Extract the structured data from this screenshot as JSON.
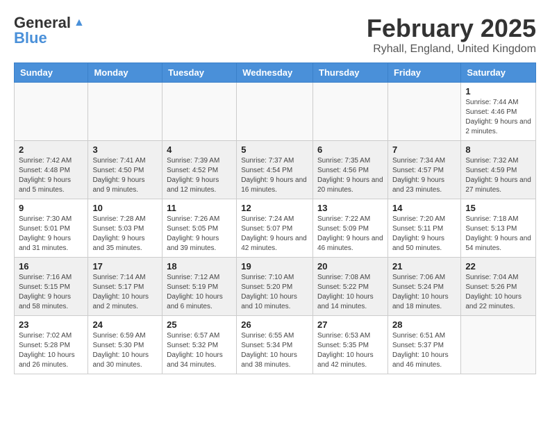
{
  "header": {
    "logo_general": "General",
    "logo_blue": "Blue",
    "title": "February 2025",
    "subtitle": "Ryhall, England, United Kingdom"
  },
  "days_of_week": [
    "Sunday",
    "Monday",
    "Tuesday",
    "Wednesday",
    "Thursday",
    "Friday",
    "Saturday"
  ],
  "weeks": [
    {
      "days": [
        {
          "num": "",
          "info": ""
        },
        {
          "num": "",
          "info": ""
        },
        {
          "num": "",
          "info": ""
        },
        {
          "num": "",
          "info": ""
        },
        {
          "num": "",
          "info": ""
        },
        {
          "num": "",
          "info": ""
        },
        {
          "num": "1",
          "info": "Sunrise: 7:44 AM\nSunset: 4:46 PM\nDaylight: 9 hours and 2 minutes."
        }
      ]
    },
    {
      "days": [
        {
          "num": "2",
          "info": "Sunrise: 7:42 AM\nSunset: 4:48 PM\nDaylight: 9 hours and 5 minutes."
        },
        {
          "num": "3",
          "info": "Sunrise: 7:41 AM\nSunset: 4:50 PM\nDaylight: 9 hours and 9 minutes."
        },
        {
          "num": "4",
          "info": "Sunrise: 7:39 AM\nSunset: 4:52 PM\nDaylight: 9 hours and 12 minutes."
        },
        {
          "num": "5",
          "info": "Sunrise: 7:37 AM\nSunset: 4:54 PM\nDaylight: 9 hours and 16 minutes."
        },
        {
          "num": "6",
          "info": "Sunrise: 7:35 AM\nSunset: 4:56 PM\nDaylight: 9 hours and 20 minutes."
        },
        {
          "num": "7",
          "info": "Sunrise: 7:34 AM\nSunset: 4:57 PM\nDaylight: 9 hours and 23 minutes."
        },
        {
          "num": "8",
          "info": "Sunrise: 7:32 AM\nSunset: 4:59 PM\nDaylight: 9 hours and 27 minutes."
        }
      ]
    },
    {
      "days": [
        {
          "num": "9",
          "info": "Sunrise: 7:30 AM\nSunset: 5:01 PM\nDaylight: 9 hours and 31 minutes."
        },
        {
          "num": "10",
          "info": "Sunrise: 7:28 AM\nSunset: 5:03 PM\nDaylight: 9 hours and 35 minutes."
        },
        {
          "num": "11",
          "info": "Sunrise: 7:26 AM\nSunset: 5:05 PM\nDaylight: 9 hours and 39 minutes."
        },
        {
          "num": "12",
          "info": "Sunrise: 7:24 AM\nSunset: 5:07 PM\nDaylight: 9 hours and 42 minutes."
        },
        {
          "num": "13",
          "info": "Sunrise: 7:22 AM\nSunset: 5:09 PM\nDaylight: 9 hours and 46 minutes."
        },
        {
          "num": "14",
          "info": "Sunrise: 7:20 AM\nSunset: 5:11 PM\nDaylight: 9 hours and 50 minutes."
        },
        {
          "num": "15",
          "info": "Sunrise: 7:18 AM\nSunset: 5:13 PM\nDaylight: 9 hours and 54 minutes."
        }
      ]
    },
    {
      "days": [
        {
          "num": "16",
          "info": "Sunrise: 7:16 AM\nSunset: 5:15 PM\nDaylight: 9 hours and 58 minutes."
        },
        {
          "num": "17",
          "info": "Sunrise: 7:14 AM\nSunset: 5:17 PM\nDaylight: 10 hours and 2 minutes."
        },
        {
          "num": "18",
          "info": "Sunrise: 7:12 AM\nSunset: 5:19 PM\nDaylight: 10 hours and 6 minutes."
        },
        {
          "num": "19",
          "info": "Sunrise: 7:10 AM\nSunset: 5:20 PM\nDaylight: 10 hours and 10 minutes."
        },
        {
          "num": "20",
          "info": "Sunrise: 7:08 AM\nSunset: 5:22 PM\nDaylight: 10 hours and 14 minutes."
        },
        {
          "num": "21",
          "info": "Sunrise: 7:06 AM\nSunset: 5:24 PM\nDaylight: 10 hours and 18 minutes."
        },
        {
          "num": "22",
          "info": "Sunrise: 7:04 AM\nSunset: 5:26 PM\nDaylight: 10 hours and 22 minutes."
        }
      ]
    },
    {
      "days": [
        {
          "num": "23",
          "info": "Sunrise: 7:02 AM\nSunset: 5:28 PM\nDaylight: 10 hours and 26 minutes."
        },
        {
          "num": "24",
          "info": "Sunrise: 6:59 AM\nSunset: 5:30 PM\nDaylight: 10 hours and 30 minutes."
        },
        {
          "num": "25",
          "info": "Sunrise: 6:57 AM\nSunset: 5:32 PM\nDaylight: 10 hours and 34 minutes."
        },
        {
          "num": "26",
          "info": "Sunrise: 6:55 AM\nSunset: 5:34 PM\nDaylight: 10 hours and 38 minutes."
        },
        {
          "num": "27",
          "info": "Sunrise: 6:53 AM\nSunset: 5:35 PM\nDaylight: 10 hours and 42 minutes."
        },
        {
          "num": "28",
          "info": "Sunrise: 6:51 AM\nSunset: 5:37 PM\nDaylight: 10 hours and 46 minutes."
        },
        {
          "num": "",
          "info": ""
        }
      ]
    }
  ]
}
